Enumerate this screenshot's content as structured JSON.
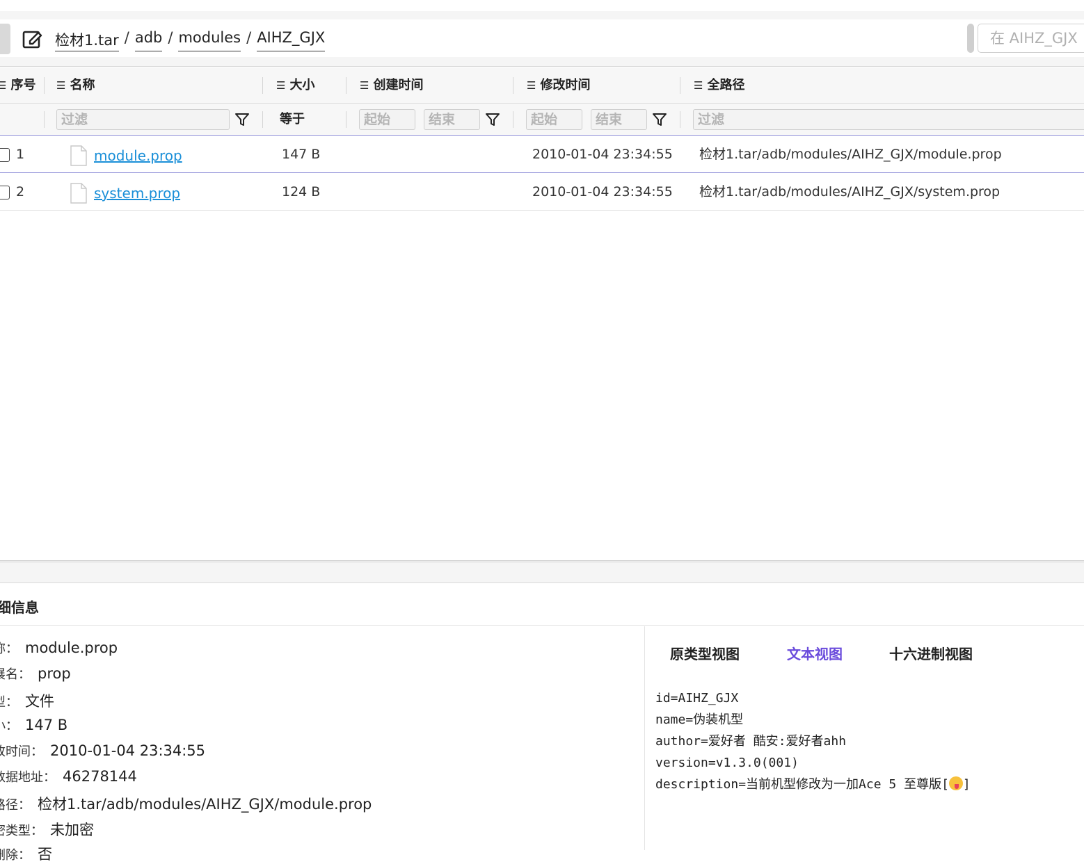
{
  "breadcrumb": [
    "检材1.tar",
    "adb",
    "modules",
    "AIHZ_GJX"
  ],
  "breadcrumb_separator": "/",
  "search": {
    "placeholder": "在 AIHZ_GJX"
  },
  "table": {
    "columns": {
      "index": "序号",
      "name": "名称",
      "size": "大小",
      "created": "创建时间",
      "modified": "修改时间",
      "fullpath": "全路径"
    },
    "filters": {
      "name_placeholder": "过滤",
      "size_op": "等于",
      "created_start": "起始",
      "created_end": "结束",
      "modified_start": "起始",
      "modified_end": "结束",
      "path_placeholder": "过滤"
    },
    "rows": [
      {
        "index": "1",
        "name": "module.prop",
        "size": "147 B",
        "created": "",
        "modified": "2010-01-04 23:34:55",
        "fullpath": "检材1.tar/adb/modules/AIHZ_GJX/module.prop"
      },
      {
        "index": "2",
        "name": "system.prop",
        "size": "124 B",
        "created": "",
        "modified": "2010-01-04 23:34:55",
        "fullpath": "检材1.tar/adb/modules/AIHZ_GJX/system.prop"
      }
    ]
  },
  "detail": {
    "title": "细信息",
    "fields": [
      {
        "key": "称：",
        "value": "module.prop"
      },
      {
        "key": "展名：",
        "value": "prop"
      },
      {
        "key": "型：",
        "value": "文件"
      },
      {
        "key": "小：",
        "value": "147 B"
      },
      {
        "key": "改时间：",
        "value": "2010-01-04 23:34:55"
      },
      {
        "key": "数据地址：",
        "value": "46278144"
      },
      {
        "key": "路径：",
        "value": "检材1.tar/adb/modules/AIHZ_GJX/module.prop"
      },
      {
        "key": "密类型：",
        "value": "未加密"
      },
      {
        "key": "删除：",
        "value": "否"
      }
    ],
    "view_tabs": [
      "原类型视图",
      "文本视图",
      "十六进制视图"
    ],
    "active_tab": "文本视图",
    "text_lines": [
      "id=AIHZ_GJX",
      "name=伪装机型",
      "author=爱好者 酷安:爱好者ahh",
      "version=v1.3.0(001)",
      "description=当前机型修改为一加Ace 5 至尊版["
    ],
    "text_line_suffix": "]",
    "emoji_icon": "face-savoring-emoji-icon"
  },
  "colors": {
    "link": "#1a8fd8",
    "active_tab": "#6a4bdc",
    "filter_border": "#8b8bd6"
  }
}
